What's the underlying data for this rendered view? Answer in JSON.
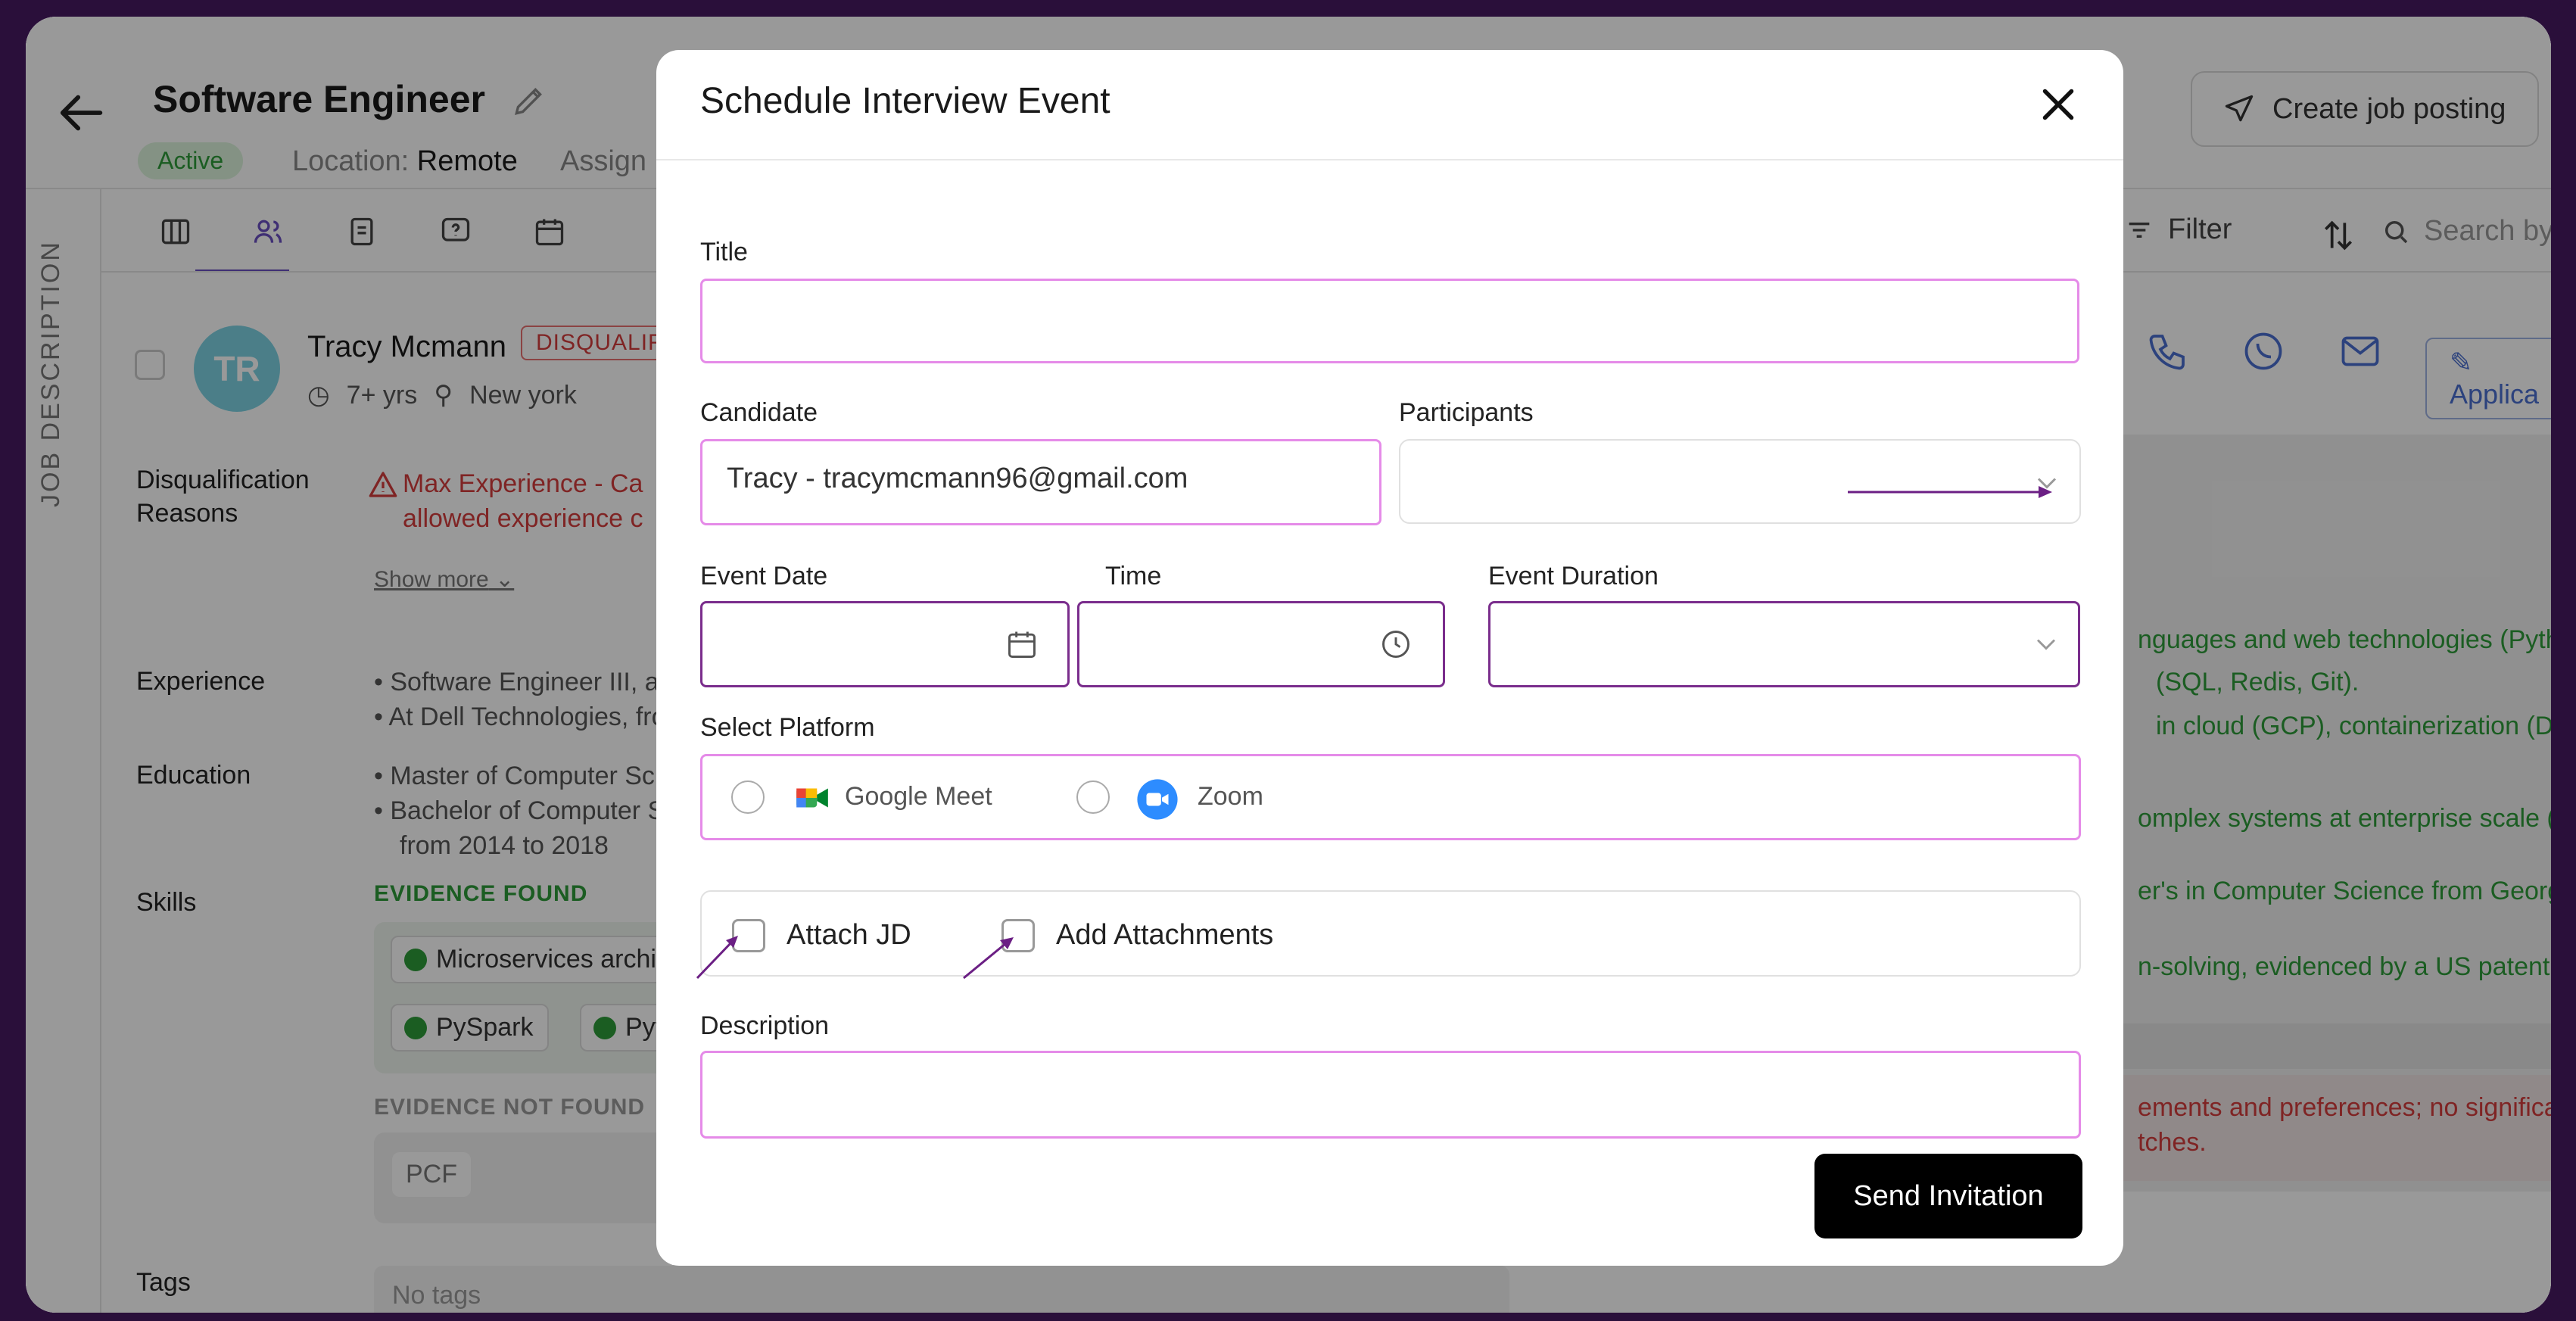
{
  "app": {
    "job_title": "Software Engineer",
    "status": "Active",
    "location_label": "Location:",
    "location_value": "Remote",
    "assign_label": "Assign",
    "create_job_button": "Create job posting",
    "side_rail_label": "JOB DESCRIPTION",
    "filter_label": "Filter",
    "search_placeholder": "Search by"
  },
  "candidate_card": {
    "initials": "TR",
    "name": "Tracy Mcmann",
    "badge": "DISQUALIFI",
    "experience": "7+ yrs",
    "location": "New york",
    "disqualification_label_1": "Disqualification",
    "disqualification_label_2": "Reasons",
    "reason_line_1": "Max Experience - Ca",
    "reason_line_2": "allowed experience c",
    "show_more": "Show more",
    "experience_label": "Experience",
    "experience_items": [
      "Software Engineer III, at V",
      "At Dell Technologies, fron"
    ],
    "education_label": "Education",
    "education_items": [
      "Master of Computer Scie",
      "Bachelor of Computer Sc",
      "from 2014 to 2018"
    ],
    "skills_label": "Skills",
    "evidence_found": "EVIDENCE FOUND",
    "skill_chips": [
      "Microservices archit",
      "PySpark",
      "Pytho"
    ],
    "evidence_not_found": "EVIDENCE NOT FOUND",
    "missing_chip": "PCF",
    "tags_label": "Tags",
    "tags_placeholder": "No tags",
    "applied_button": "Applica"
  },
  "evaluation": {
    "green_lines": [
      "nguages and web technologies (Pyth",
      "(SQL, Redis, Git).",
      "in cloud (GCP), containerization (Doc",
      "omplex systems at enterprise scale (e.",
      "er's in Computer Science from Georg",
      "n-solving, evidenced by a US patent a"
    ],
    "red_lines": [
      "ements and preferences; no significar",
      "tches."
    ]
  },
  "modal": {
    "title": "Schedule Interview Event",
    "title_label": "Title",
    "title_value": "",
    "candidate_label": "Candidate",
    "candidate_value": "Tracy - tracymcmann96@gmail.com",
    "participants_label": "Participants",
    "event_date_label": "Event Date",
    "time_label": "Time",
    "duration_label": "Event Duration",
    "platform_label": "Select Platform",
    "platform_options": [
      "Google Meet",
      "Zoom"
    ],
    "attach_jd_label": "Attach JD",
    "add_attachments_label": "Add Attachments",
    "description_label": "Description",
    "send_button": "Send Invitation"
  },
  "colors": {
    "field_highlight": "#e58be8",
    "field_focus": "#7a2d8c",
    "primary_button": "#000000",
    "active_green": "#2e9b3a",
    "error_red": "#d43d3d"
  }
}
